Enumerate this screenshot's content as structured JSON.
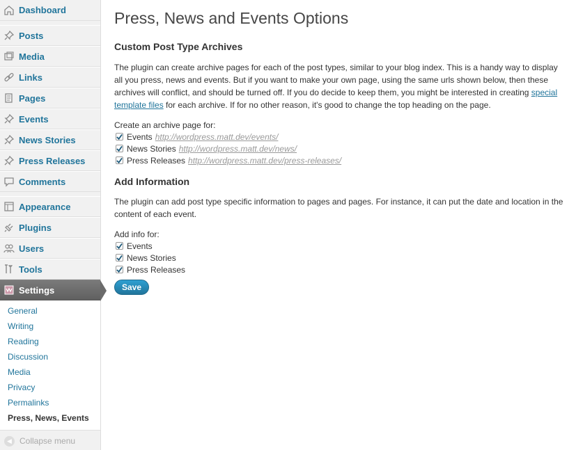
{
  "sidebar": {
    "items": [
      {
        "label": "Dashboard",
        "icon": "dashboard-icon"
      },
      {
        "label": "Posts",
        "icon": "pushpin-icon"
      },
      {
        "label": "Media",
        "icon": "media-icon"
      },
      {
        "label": "Links",
        "icon": "link-icon"
      },
      {
        "label": "Pages",
        "icon": "pages-icon"
      },
      {
        "label": "Events",
        "icon": "pushpin-icon"
      },
      {
        "label": "News Stories",
        "icon": "pushpin-icon"
      },
      {
        "label": "Press Releases",
        "icon": "pushpin-icon"
      },
      {
        "label": "Comments",
        "icon": "comment-icon"
      },
      {
        "label": "Appearance",
        "icon": "appearance-icon"
      },
      {
        "label": "Plugins",
        "icon": "plugin-icon"
      },
      {
        "label": "Users",
        "icon": "users-icon"
      },
      {
        "label": "Tools",
        "icon": "tools-icon"
      },
      {
        "label": "Settings",
        "icon": "settings-icon"
      }
    ],
    "submenu": [
      "General",
      "Writing",
      "Reading",
      "Discussion",
      "Media",
      "Privacy",
      "Permalinks",
      "Press, News, Events"
    ],
    "collapse_label": "Collapse menu"
  },
  "main": {
    "title": "Press, News and Events Options",
    "archives": {
      "heading": "Custom Post Type Archives",
      "desc_before": "The plugin can create archive pages for each of the post types, similar to your blog index. This is a handy way to display all you press, news and events. But if you want to make your own page, using the same urls shown below, then these archives will conflict, and should be turned off. If you do decide to keep them, you might be interested in creating ",
      "desc_link": "special template files",
      "desc_after": " for each archive. If for no other reason, it's good to change the top heading on the page.",
      "field_label": "Create an archive page for:",
      "options": [
        {
          "label": "Events",
          "url": "http://wordpress.matt.dev/events/",
          "checked": true
        },
        {
          "label": "News Stories",
          "url": "http://wordpress.matt.dev/news/",
          "checked": true
        },
        {
          "label": "Press Releases",
          "url": "http://wordpress.matt.dev/press-releases/",
          "checked": true
        }
      ]
    },
    "info": {
      "heading": "Add Information",
      "desc": "The plugin can add post type specific information to pages and pages. For instance, it can put the date and location in the content of each event.",
      "field_label": "Add info for:",
      "options": [
        {
          "label": "Events",
          "checked": true
        },
        {
          "label": "News Stories",
          "checked": true
        },
        {
          "label": "Press Releases",
          "checked": true
        }
      ]
    },
    "save_label": "Save"
  },
  "colors": {
    "link": "#21759b",
    "active_menu": "#6b6b6b",
    "button": "#21759b"
  }
}
